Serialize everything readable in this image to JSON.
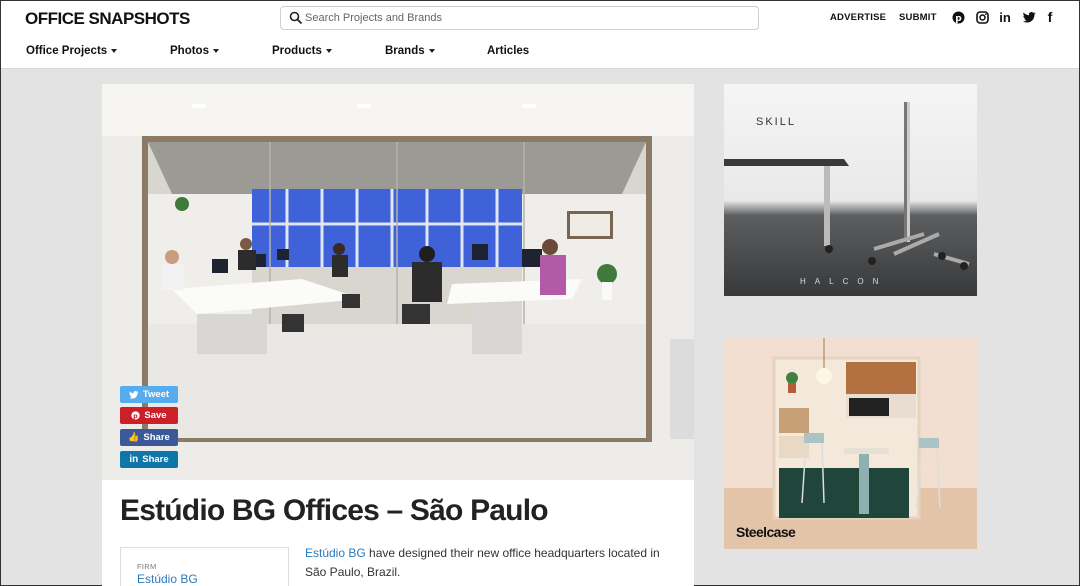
{
  "header": {
    "logo": "OFFICE SNAPSHOTS",
    "search_placeholder": "Search Projects and Brands",
    "links": [
      "ADVERTISE",
      "SUBMIT"
    ],
    "social": [
      "pinterest-icon",
      "instagram-icon",
      "linkedin-icon",
      "twitter-icon",
      "facebook-icon"
    ]
  },
  "nav": [
    "Office Projects",
    "Photos",
    "Products",
    "Brands",
    "Articles"
  ],
  "share": {
    "tweet": "Tweet",
    "save": "Save",
    "fb_share": "Share",
    "in_share": "Share"
  },
  "article": {
    "title": "Estúdio BG Offices – São Paulo",
    "firm_label": "FIRM",
    "firm_value": "Estúdio BG",
    "intro_link": "Estúdio BG",
    "intro_rest": " have designed their new office headquarters located in São Paulo, Brazil."
  },
  "ads": {
    "ad1_title": "SKILL",
    "ad1_brand": "HALCON",
    "ad2_brand": "Steelcase"
  },
  "colors": {
    "twitter": "#55acee",
    "pinterest": "#cb2027",
    "facebook": "#3b5998",
    "linkedin": "#0e76a8",
    "link": "#2a7bbd"
  }
}
